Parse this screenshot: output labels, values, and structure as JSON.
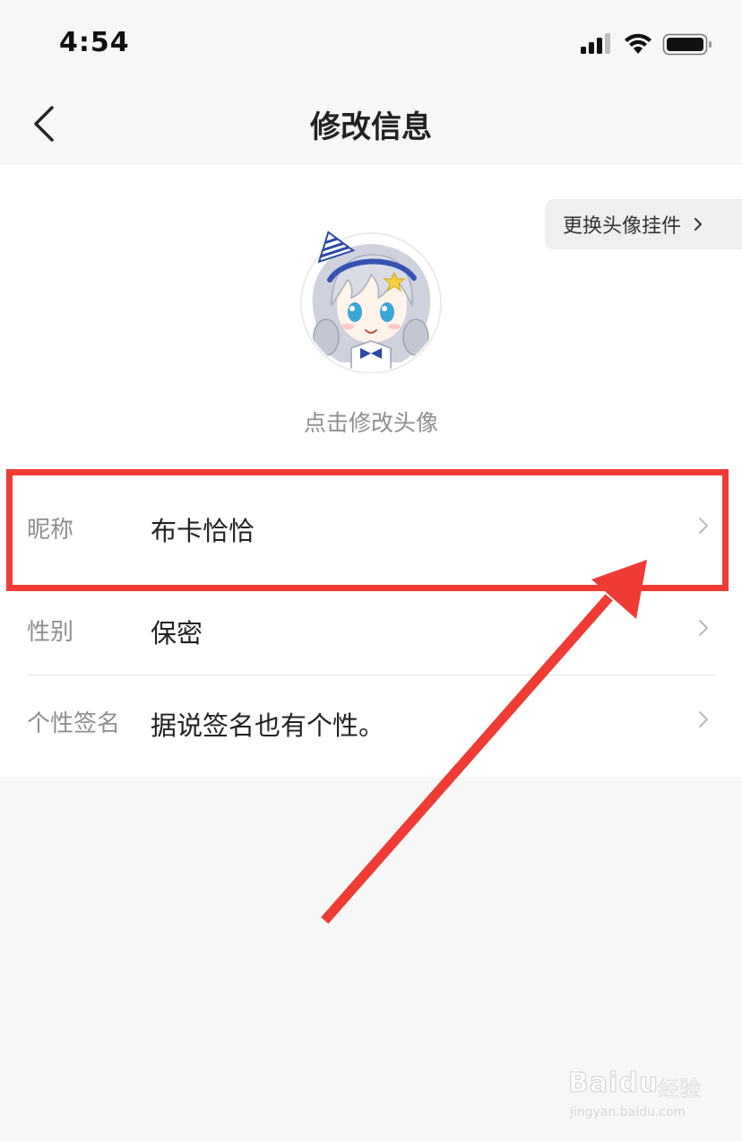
{
  "status_bar": {
    "time": "4:54",
    "icons": [
      "signal-icon",
      "wifi-icon",
      "battery-icon"
    ]
  },
  "nav": {
    "back_icon": "chevron-left-icon",
    "title": "修改信息"
  },
  "avatar_section": {
    "pendant_button_label": "更换头像挂件",
    "hint": "点击修改头像"
  },
  "fields": [
    {
      "label": "昵称",
      "value": "布卡恰恰"
    },
    {
      "label": "性别",
      "value": "保密"
    },
    {
      "label": "个性签名",
      "value": "据说签名也有个性。"
    }
  ],
  "annotation": {
    "highlight_color": "#f03b35"
  },
  "watermark": {
    "brand": "Baidu",
    "suffix": "经验",
    "url": "jingyan.baidu.com"
  },
  "colors": {
    "background": "#f7f7f7",
    "card": "#ffffff",
    "label": "#8e8e93",
    "text": "#222222",
    "accent_red": "#f03b35"
  }
}
